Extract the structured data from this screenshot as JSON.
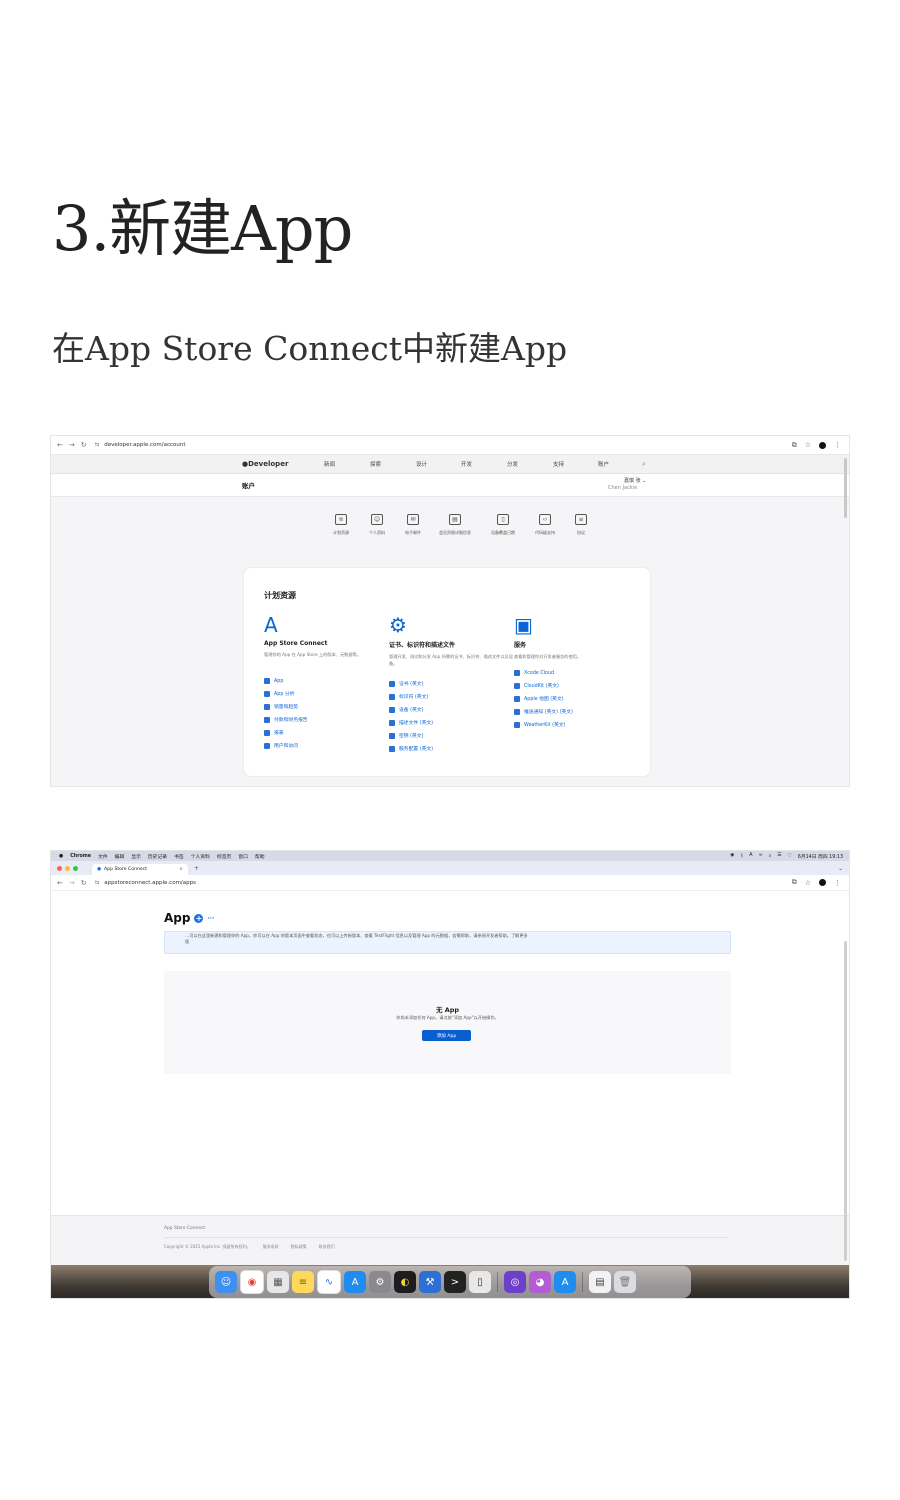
{
  "article": {
    "heading": "3.新建App",
    "subheading": "在App Store Connect中新建App"
  },
  "shot1": {
    "url": "developer.apple.com/account",
    "nav": {
      "logo": "Developer",
      "items": [
        "新闻",
        "探索",
        "设计",
        "开发",
        "分发",
        "支持",
        "账户"
      ]
    },
    "account_title": "账户",
    "user_name": "嘉琪 张 ⌄",
    "user_sub": "Chen Jackie",
    "icon_row": [
      {
        "icon": "stack-icon",
        "label": "计划资源"
      },
      {
        "icon": "person-card-icon",
        "label": "个人资料"
      },
      {
        "icon": "envelope-icon",
        "label": "电子邮件"
      },
      {
        "icon": "id-card-icon",
        "label": "会员资格详细信息"
      },
      {
        "icon": "device-icon",
        "label": "设备覆盖日期"
      },
      {
        "icon": "code-icon",
        "label": "代码级支持"
      },
      {
        "icon": "document-icon",
        "label": "协议"
      }
    ],
    "panel_title": "计划资源",
    "columns": [
      {
        "icon": "app-store-icon",
        "title": "App Store Connect",
        "desc": "管理你的 App 在 App Store 上的版本、元数据等。",
        "links": [
          "App",
          "App 分析",
          "销量和趋势",
          "付款和财务报告",
          "报表",
          "用户和访问"
        ]
      },
      {
        "icon": "gear-badge-icon",
        "title": "证书、标识符和描述文件",
        "desc": "管理开发、测试和分发 App 所需的证书、标识符、描述文件以及设备。",
        "links": [
          "证书 (英文)",
          "标识符 (英文)",
          "设备 (英文)",
          "描述文件 (英文)",
          "密钥 (英文)",
          "服务配置 (英文)"
        ]
      },
      {
        "icon": "window-icon",
        "title": "服务",
        "desc": "查看和管理你对开发者服务的使用。",
        "links": [
          "Xcode Cloud",
          "CloudKit (英文)",
          "Apple 地图 (英文)",
          "推送通知 (英文) (英文)",
          "WeatherKit (英文)"
        ]
      }
    ]
  },
  "shot2": {
    "menubar": [
      "Chrome",
      "文件",
      "编辑",
      "显示",
      "历史记录",
      "书签",
      "个人资料",
      "标签页",
      "窗口",
      "帮助"
    ],
    "clock": "6月14日 周四 19:13",
    "tab_title": "App Store Connect",
    "tab_close": "×",
    "new_tab": "+",
    "url": "appstoreconnect.apple.com/apps",
    "app_title": "App",
    "plus": "+",
    "more": "···",
    "banner_line1": "…可以在这里新建和管理你的 App。你可以在 App 的版本页面中查看状态，也可以上传新版本、查看 TestFlight 信息以及管理 App 的元数据，若需帮助，请参阅开发者帮助。了解更多",
    "banner_line2": "版",
    "empty_title": "无 App",
    "empty_desc": "你尚未添加任何 App。请点按\"添加 App\"以开始操作。",
    "add_button": "添加 App",
    "footer_brand": "App Store Connect",
    "footer_links": [
      "Copyright © 2025 Apple Inc. 保留所有权利。",
      "服务条款",
      "隐私政策",
      "联系我们"
    ],
    "dock_apps": [
      "finder-icon",
      "chrome-icon",
      "launchpad-icon",
      "notes-icon",
      "freeform-icon",
      "app-store-icon",
      "settings-icon",
      "vpn-icon",
      "xcode-icon",
      "terminal-icon",
      "simulator-icon",
      "github-icon",
      "cat-icon",
      "app-store-icon",
      "preview-icon",
      "trash-icon"
    ]
  },
  "colors": {
    "accent": "#0a66d8",
    "button": "#0a5fd0",
    "banner_bg": "#ecf3fe"
  }
}
